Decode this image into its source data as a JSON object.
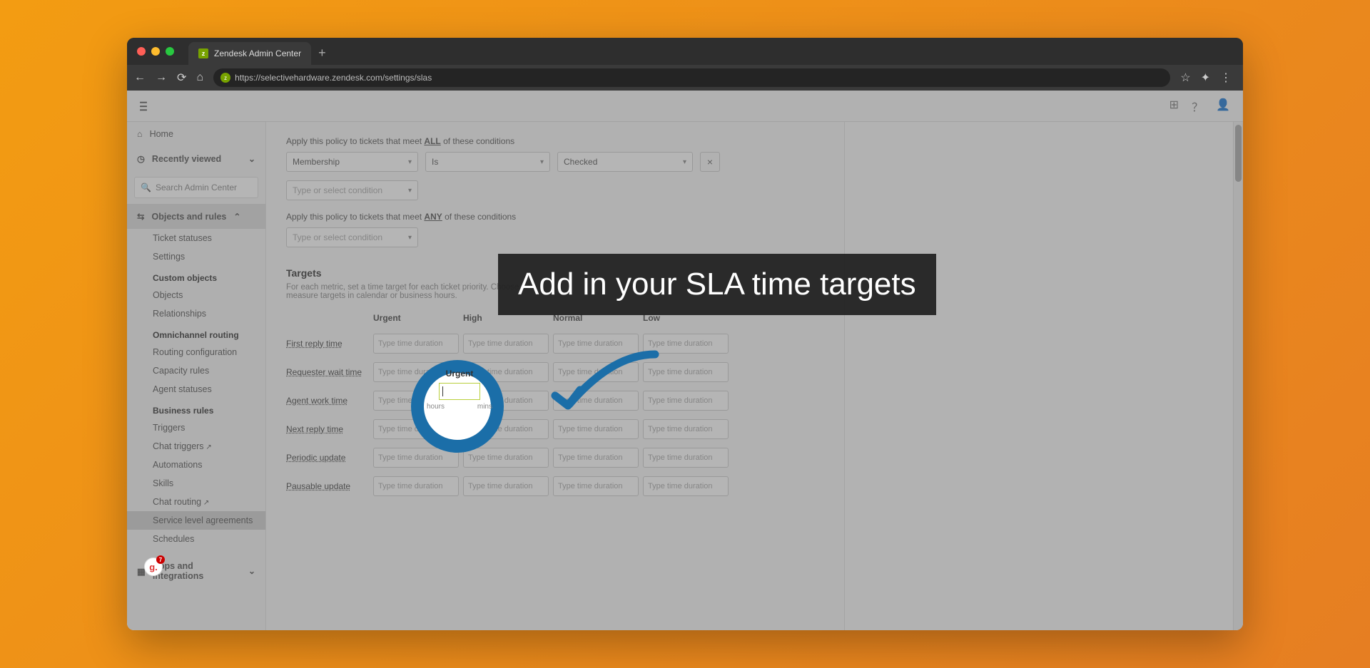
{
  "browser": {
    "tab_title": "Zendesk Admin Center",
    "url": "https://selectivehardware.zendesk.com/settings/slas"
  },
  "sidebar": {
    "home": "Home",
    "recent": "Recently viewed",
    "search_placeholder": "Search Admin Center",
    "objects": "Objects and rules",
    "items": {
      "ticket_statuses": "Ticket statuses",
      "settings": "Settings",
      "custom_objects_h": "Custom objects",
      "objects": "Objects",
      "relationships": "Relationships",
      "omni_h": "Omnichannel routing",
      "routing_config": "Routing configuration",
      "capacity": "Capacity rules",
      "agent_statuses": "Agent statuses",
      "business_h": "Business rules",
      "triggers": "Triggers",
      "chat_triggers": "Chat triggers",
      "automations": "Automations",
      "skills": "Skills",
      "chat_routing": "Chat routing",
      "sla": "Service level agreements",
      "schedules": "Schedules",
      "apps": "Apps and integrations"
    }
  },
  "content": {
    "all_label_pre": "Apply this policy to tickets that meet ",
    "all_label_b": "ALL",
    "all_label_post": " of these conditions",
    "any_label_pre": "Apply this policy to tickets that meet ",
    "any_label_b": "ANY",
    "any_label_post": " of these conditions",
    "cond_field": "Membership",
    "cond_op": "Is",
    "cond_val": "Checked",
    "cond_placeholder": "Type or select condition",
    "targets_title": "Targets",
    "targets_desc": "For each metric, set a time target for each ticket priority. Choose to measure targets in calendar or business hours.",
    "priorities": {
      "urgent": "Urgent",
      "high": "High",
      "normal": "Normal",
      "low": "Low"
    },
    "metrics": {
      "first_reply": "First reply time",
      "requester_wait": "Requester wait time",
      "agent_work": "Agent work time",
      "next_reply": "Next reply time",
      "periodic": "Periodic update",
      "pausable": "Pausable update"
    },
    "input_placeholder": "Type time duration",
    "spot_hours": "hours",
    "spot_mins": "mins"
  },
  "callout": "Add in your SLA time targets",
  "badge_count": "7"
}
